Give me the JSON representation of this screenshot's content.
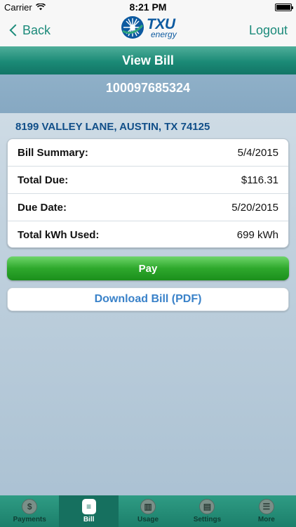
{
  "status_bar": {
    "carrier": "Carrier",
    "time": "8:21 PM",
    "battery_level": 1.0
  },
  "nav": {
    "back_label": "Back",
    "logout_label": "Logout",
    "logo_brand": "TXU",
    "logo_sub": "energy"
  },
  "page": {
    "title": "View Bill",
    "account_number": "100097685324",
    "address": "8199 VALLEY LANE, AUSTIN, TX 74125"
  },
  "summary": {
    "rows": [
      {
        "label": "Bill Summary:",
        "value": "5/4/2015"
      },
      {
        "label": "Total Due:",
        "value": "$116.31"
      },
      {
        "label": "Due Date:",
        "value": "5/20/2015"
      },
      {
        "label": "Total kWh Used:",
        "value": "699 kWh"
      }
    ]
  },
  "actions": {
    "pay_label": "Pay",
    "download_label": "Download Bill (PDF)"
  },
  "tabs": [
    {
      "label": "Payments",
      "icon": "dollar-icon",
      "glyph": "$",
      "active": false
    },
    {
      "label": "Bill",
      "icon": "bill-icon",
      "glyph": "≡",
      "active": true
    },
    {
      "label": "Usage",
      "icon": "usage-icon",
      "glyph": "▥",
      "active": false
    },
    {
      "label": "Settings",
      "icon": "settings-icon",
      "glyph": "▤",
      "active": false
    },
    {
      "label": "More",
      "icon": "more-icon",
      "glyph": "☰",
      "active": false
    }
  ],
  "colors": {
    "accent": "#1b8a7a",
    "pay_green": "#2ea82c",
    "link_blue": "#3a82c9",
    "address_blue": "#104e88"
  }
}
